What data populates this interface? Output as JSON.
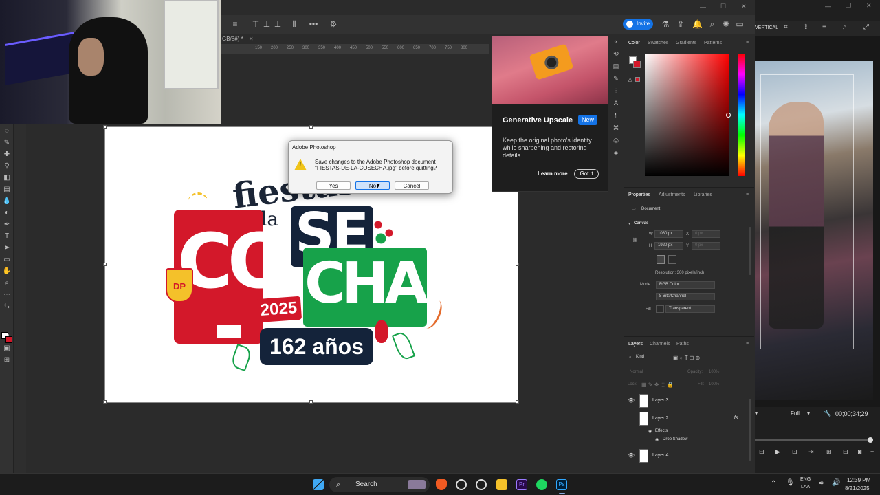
{
  "photoshop": {
    "doc_tab": "GB/8#) *",
    "ruler_ticks": [
      "150",
      "200",
      "250",
      "300",
      "350",
      "400",
      "450",
      "500",
      "550",
      "600",
      "650",
      "700",
      "750",
      "800"
    ],
    "invite_label": "Invite"
  },
  "dialog": {
    "title": "Adobe Photoshop",
    "message": "Save changes to the Adobe Photoshop document \"FIESTAS-DE-LA-COSECHA.jpg\" before quitting?",
    "yes_label": "Yes",
    "no_label": "No",
    "cancel_label": "Cancel"
  },
  "generative_upscale": {
    "title": "Generative Upscale",
    "badge": "New",
    "description": "Keep the original photo's identity while sharpening and restoring details.",
    "learn_more": "Learn more",
    "got_it": "Got it"
  },
  "color_panel": {
    "tabs": [
      "Color",
      "Swatches",
      "Gradients",
      "Patterns"
    ]
  },
  "properties": {
    "tabs": [
      "Properties",
      "Adjustments",
      "Libraries"
    ],
    "document_label": "Document",
    "canvas_label": "Canvas",
    "w_label": "W",
    "w_value": "1080 px",
    "h_label": "H",
    "h_value": "1920 px",
    "x_label": "X",
    "x_value": "0 px",
    "y_label": "Y",
    "y_value": "0 px",
    "resolution": "Resolution: 300 pixels/inch",
    "mode_label": "Mode",
    "mode_value": "RGB Color",
    "bits_value": "8 Bits/Channel",
    "fill_label": "Fill",
    "fill_value": "Transparent"
  },
  "layers": {
    "tabs": [
      "Layers",
      "Channels",
      "Paths"
    ],
    "kind_label": "Kind",
    "blend": "Normal",
    "opacity_label": "Opacity:",
    "opacity_value": "100%",
    "lock_label": "Lock:",
    "fill_label": "Fill:",
    "fill_value": "100%",
    "items": [
      {
        "name": "Layer 3"
      },
      {
        "name": "Layer 2",
        "fx": "fx"
      },
      {
        "name": "Effects"
      },
      {
        "name": "Drop Shadow"
      },
      {
        "name": "Layer 4"
      }
    ]
  },
  "video_editor": {
    "menu_label": "VERTICAL",
    "quality": "Full",
    "timecode": "00;00;34;29"
  },
  "artwork": {
    "line1": "fiestas",
    "line2": "de la",
    "co": "CO",
    "se": "SE",
    "cha": "CHA",
    "year": "2025",
    "years": "162 años",
    "shield": "DP"
  },
  "taskbar": {
    "search_label": "Search",
    "lang_top": "ENG",
    "lang_bottom": "LAA",
    "time": "12:39 PM",
    "date": "8/21/2025"
  },
  "colors": {
    "accent": "#1473e6",
    "red": "#d3182a",
    "green": "#17a24a",
    "navy": "#14233a"
  }
}
